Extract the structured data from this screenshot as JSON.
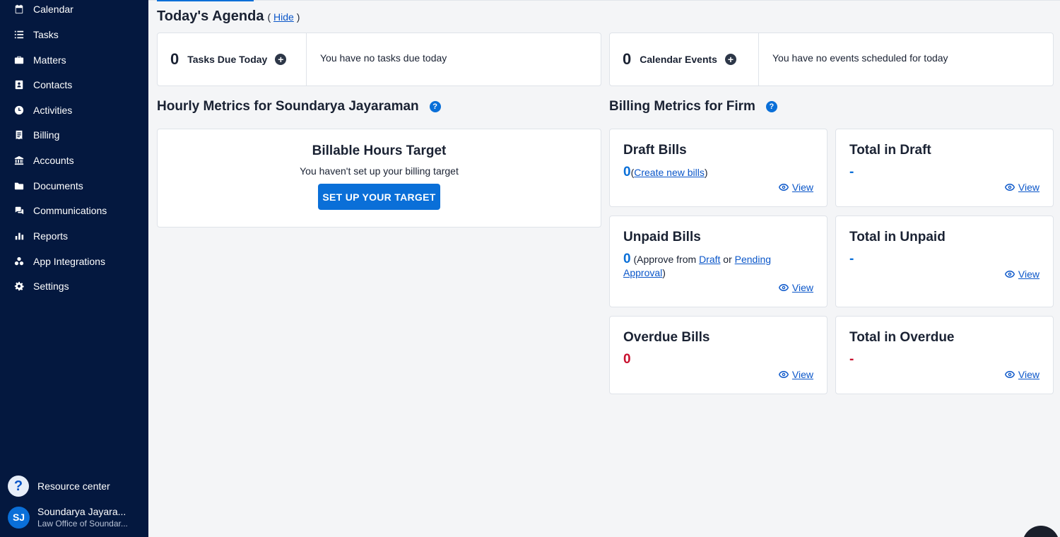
{
  "sidebar": {
    "items": [
      {
        "label": "Calendar",
        "icon": "calendar-icon"
      },
      {
        "label": "Tasks",
        "icon": "list-icon"
      },
      {
        "label": "Matters",
        "icon": "briefcase-icon"
      },
      {
        "label": "Contacts",
        "icon": "contact-card-icon"
      },
      {
        "label": "Activities",
        "icon": "clock-icon"
      },
      {
        "label": "Billing",
        "icon": "receipt-icon"
      },
      {
        "label": "Accounts",
        "icon": "bank-icon"
      },
      {
        "label": "Documents",
        "icon": "folder-icon"
      },
      {
        "label": "Communications",
        "icon": "chat-icon"
      },
      {
        "label": "Reports",
        "icon": "bar-chart-icon"
      },
      {
        "label": "App Integrations",
        "icon": "integrations-icon"
      },
      {
        "label": "Settings",
        "icon": "gear-icon"
      }
    ],
    "resource_center": {
      "icon_glyph": "?",
      "label": "Resource center"
    },
    "user": {
      "initials": "SJ",
      "name": "Soundarya Jayara...",
      "firm": "Law Office of Soundar..."
    }
  },
  "agenda": {
    "title": "Today's Agenda",
    "hide_prefix": "(",
    "hide_label": "Hide",
    "hide_suffix": ")",
    "tasks": {
      "count": "0",
      "label": "Tasks Due Today",
      "plus": "+",
      "empty": "You have no tasks due today"
    },
    "events": {
      "count": "0",
      "label": "Calendar Events",
      "plus": "+",
      "empty": "You have no events scheduled for today"
    }
  },
  "hourly": {
    "title": "Hourly Metrics for Soundarya Jayaraman",
    "help": "?",
    "card_title": "Billable Hours Target",
    "card_text": "You haven't set up your billing target",
    "button": "SET UP YOUR TARGET"
  },
  "billing": {
    "title": "Billing Metrics for Firm",
    "help": "?",
    "view_label": "View",
    "draft": {
      "title": "Draft Bills",
      "count": "0",
      "open": "(",
      "link": "Create new bills",
      "close": ")"
    },
    "total_draft": {
      "title": "Total in Draft",
      "value": "-"
    },
    "unpaid": {
      "title": "Unpaid Bills",
      "count": "0",
      "text1": "(Approve from",
      "link1": "Draft",
      "text2": "or",
      "link2": "Pending Approval",
      "close": ")"
    },
    "total_unpaid": {
      "title": "Total in Unpaid",
      "value": "-"
    },
    "overdue": {
      "title": "Overdue Bills",
      "count": "0"
    },
    "total_overdue": {
      "title": "Total in Overdue",
      "value": "-"
    }
  },
  "colors": {
    "sidebar": "#04183f",
    "accent": "#0a6fd8",
    "danger": "#c8102e"
  }
}
